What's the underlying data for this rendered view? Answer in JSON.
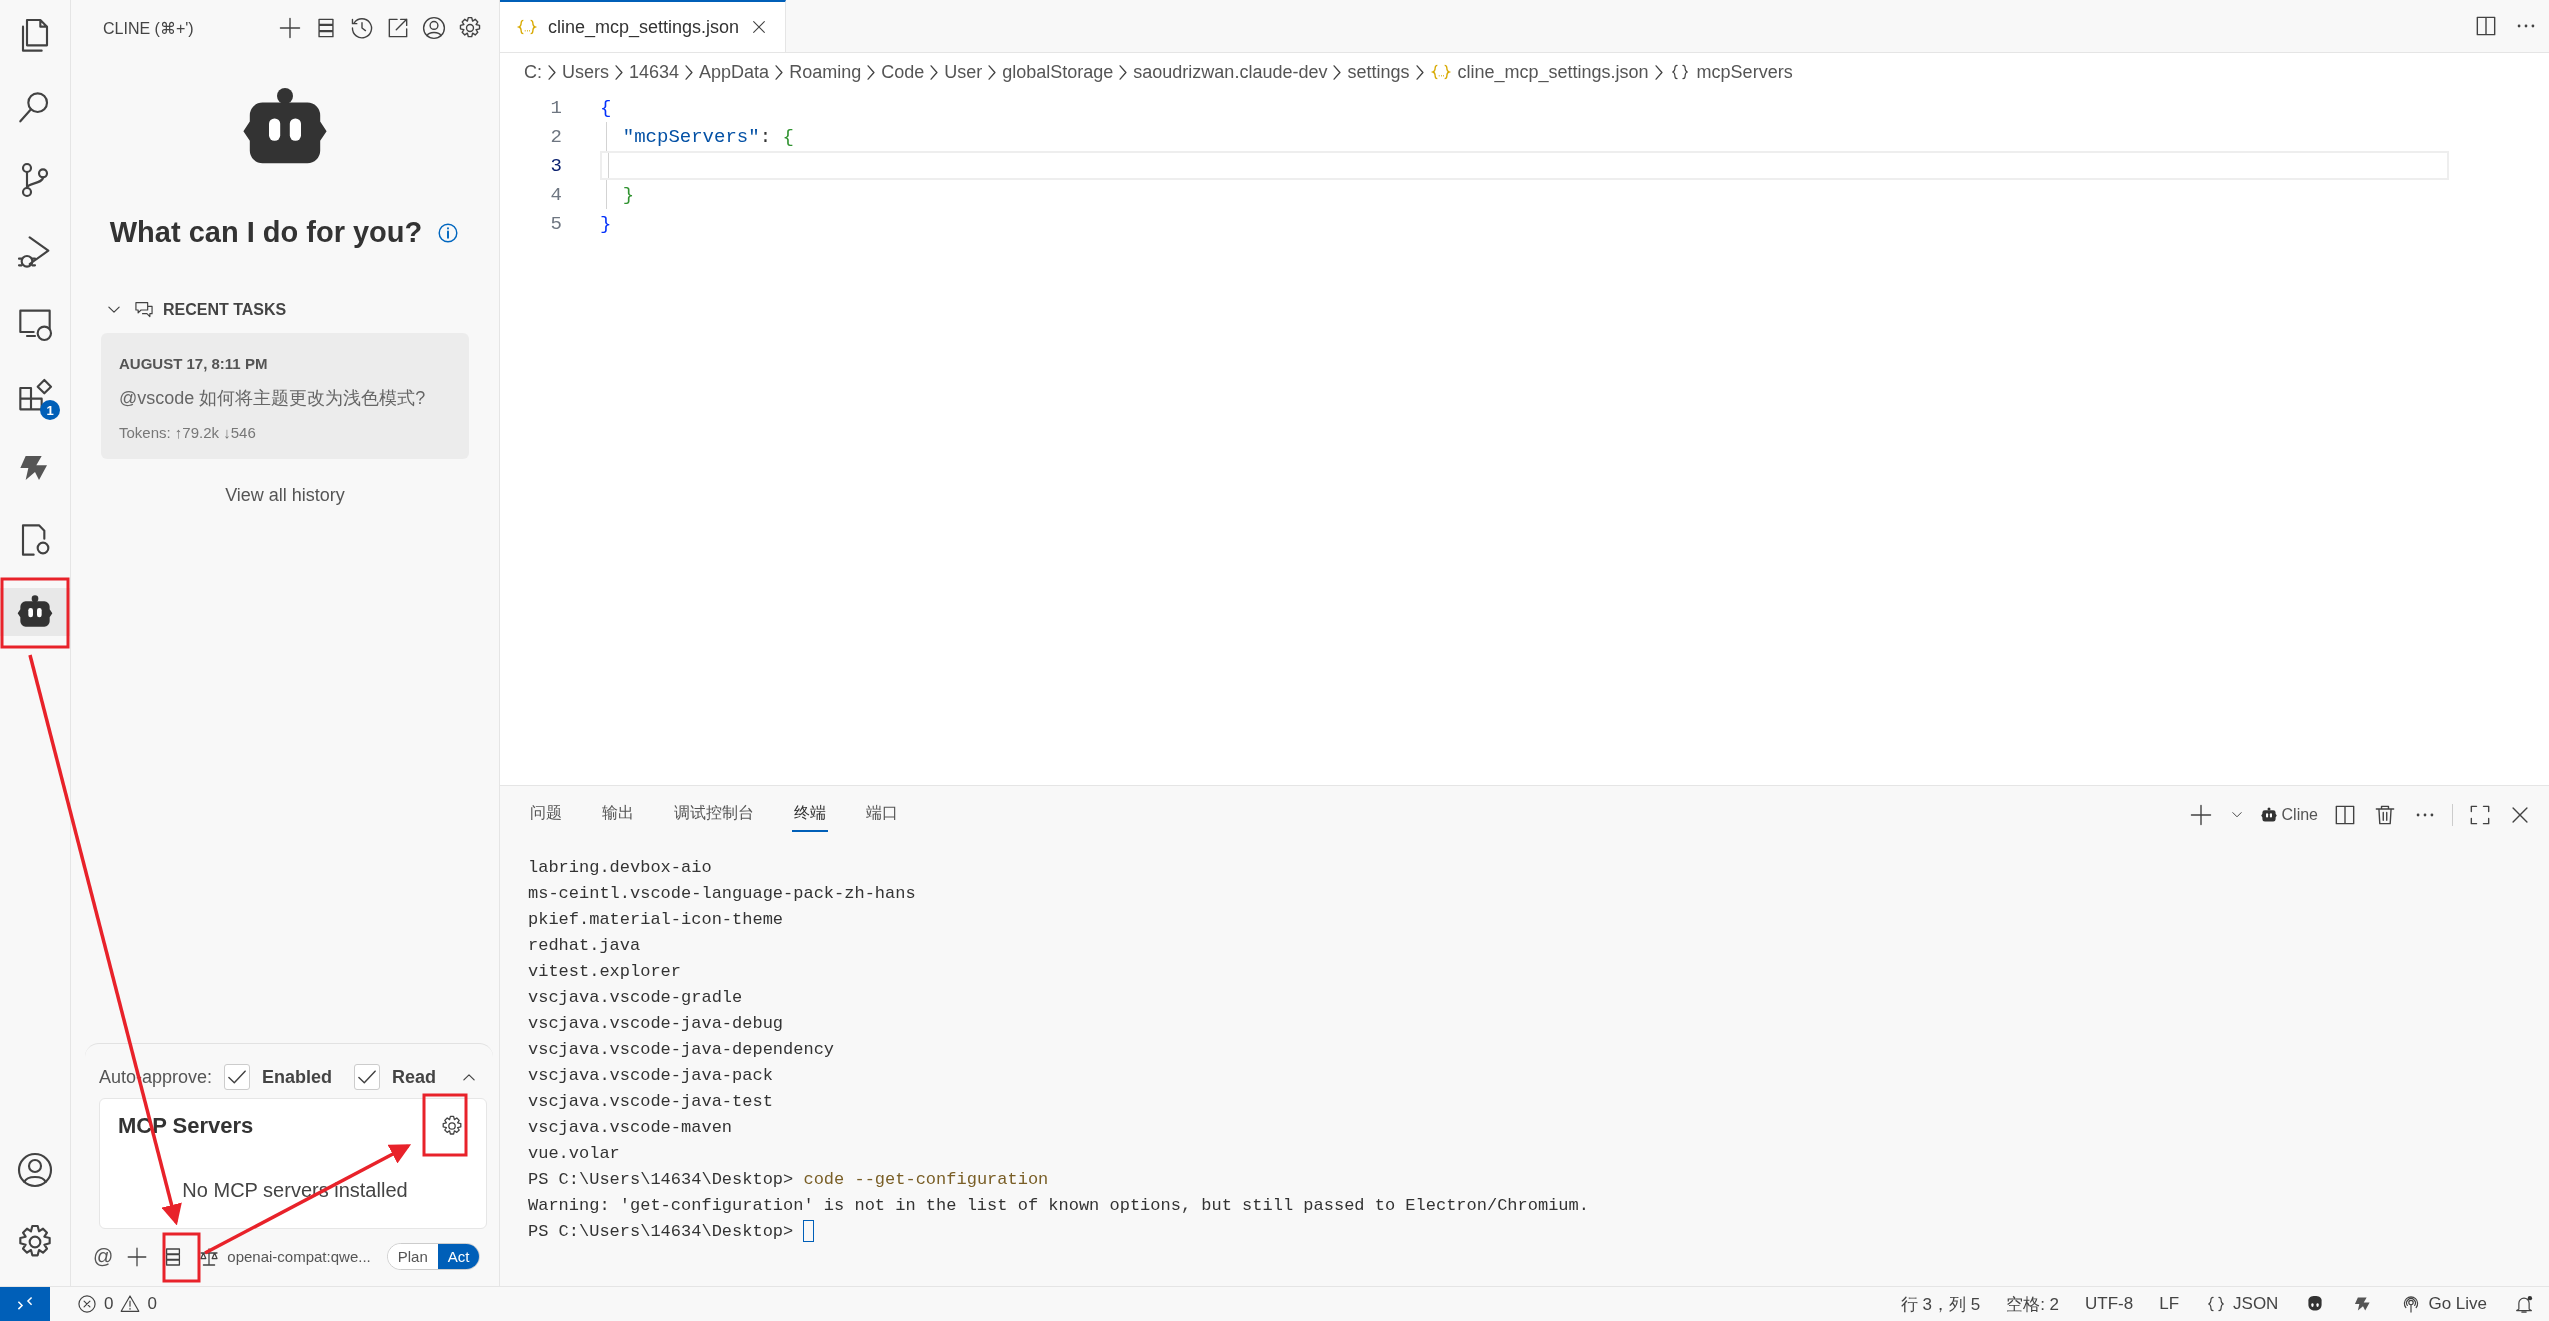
{
  "activity_bar": {
    "items": [
      {
        "kind": "files",
        "selected": false
      },
      {
        "kind": "search",
        "selected": false
      },
      {
        "kind": "branch",
        "selected": false
      },
      {
        "kind": "debug",
        "selected": false
      },
      {
        "kind": "remote",
        "selected": false
      },
      {
        "kind": "extensions",
        "selected": false,
        "badge": "1"
      },
      {
        "kind": "knot",
        "selected": false
      },
      {
        "kind": "gear-doc",
        "selected": false
      },
      {
        "kind": "robot",
        "selected": true
      }
    ],
    "bottom": [
      {
        "kind": "account"
      },
      {
        "kind": "gear"
      }
    ]
  },
  "sidebar": {
    "title": "CLINE (⌘+')",
    "actions": [
      {
        "kind": "plus"
      },
      {
        "kind": "server"
      },
      {
        "kind": "history"
      },
      {
        "kind": "popout"
      },
      {
        "kind": "account"
      },
      {
        "kind": "gear"
      }
    ],
    "heading": "What can I do for you?",
    "recent_tasks": {
      "label": "RECENT TASKS",
      "expanded": true,
      "tasks": [
        {
          "date": "AUGUST 17, 8:11 PM",
          "text": "@vscode 如何将主题更改为浅色模式?",
          "tokens": "Tokens: ↑79.2k ↓546"
        }
      ],
      "link": "View all history"
    },
    "auto_approve": {
      "label": "Auto-approve:",
      "options": [
        {
          "label": "Enabled",
          "checked": true
        },
        {
          "label": "Read",
          "checked": true
        }
      ],
      "expanded": true
    },
    "mcp": {
      "title": "MCP Servers",
      "empty": "No MCP servers installed"
    },
    "toolbar": {
      "at": "@",
      "model": "openai-compat:qwe...",
      "modes": [
        {
          "label": "Plan",
          "selected": false
        },
        {
          "label": "Act",
          "selected": true
        }
      ]
    }
  },
  "editor": {
    "tabs": [
      {
        "label": "cline_mcp_settings.json",
        "selected": true
      }
    ],
    "breadcrumb": [
      {
        "text": "C:"
      },
      {
        "text": "Users"
      },
      {
        "text": "14634"
      },
      {
        "text": "AppData"
      },
      {
        "text": "Roaming"
      },
      {
        "text": "Code"
      },
      {
        "text": "User"
      },
      {
        "text": "globalStorage"
      },
      {
        "text": "saoudrizwan.claude-dev"
      },
      {
        "text": "settings"
      },
      {
        "text": "cline_mcp_settings.json",
        "kind": "json-file"
      },
      {
        "text": "mcpServers",
        "kind": "object"
      }
    ],
    "lines": [
      {
        "number": "1",
        "current": false,
        "guide": false,
        "tokens": [
          {
            "text": "{",
            "kind": "bracket1"
          }
        ]
      },
      {
        "number": "2",
        "current": false,
        "guide": true,
        "tokens": [
          {
            "text": "  \"mcpServers\"",
            "kind": "key"
          },
          {
            "text": ": ",
            "kind": "plain"
          },
          {
            "text": "{",
            "kind": "bracket2"
          }
        ]
      },
      {
        "number": "3",
        "current": true,
        "guide": true
      },
      {
        "number": "4",
        "current": false,
        "guide": true,
        "tokens": [
          {
            "text": "  }",
            "kind": "bracket2"
          }
        ]
      },
      {
        "number": "5",
        "current": false,
        "guide": false,
        "tokens": [
          {
            "text": "}",
            "kind": "bracket1"
          }
        ]
      }
    ]
  },
  "panel": {
    "tabs": [
      {
        "label": "问题",
        "selected": false
      },
      {
        "label": "输出",
        "selected": false
      },
      {
        "label": "调试控制台",
        "selected": false
      },
      {
        "label": "终端",
        "selected": true
      },
      {
        "label": "端口",
        "selected": false
      }
    ],
    "terminal_name": "Cline",
    "lines": [
      {
        "text": "labring.devbox-aio"
      },
      {
        "text": "ms-ceintl.vscode-language-pack-zh-hans"
      },
      {
        "text": "pkief.material-icon-theme"
      },
      {
        "text": "redhat.java"
      },
      {
        "text": "vitest.explorer"
      },
      {
        "text": "vscjava.vscode-gradle"
      },
      {
        "text": "vscjava.vscode-java-debug"
      },
      {
        "text": "vscjava.vscode-java-dependency"
      },
      {
        "text": "vscjava.vscode-java-pack"
      },
      {
        "text": "vscjava.vscode-java-test"
      },
      {
        "text": "vscjava.vscode-maven"
      },
      {
        "text": "vue.volar"
      },
      {
        "text": "PS C:\\Users\\14634\\Desktop> ",
        "command": "code --get-configuration"
      },
      {
        "text": "Warning: 'get-configuration' is not in the list of known options, but still passed to Electron/Chromium."
      },
      {
        "text": "PS C:\\Users\\14634\\Desktop> ",
        "cursor": true
      }
    ]
  },
  "status_bar": {
    "errors": "0",
    "warnings": "0",
    "position": "行 3，列 5",
    "indent": "空格: 2",
    "encoding": "UTF-8",
    "eol": "LF",
    "language": "JSON",
    "live": "Go Live"
  }
}
